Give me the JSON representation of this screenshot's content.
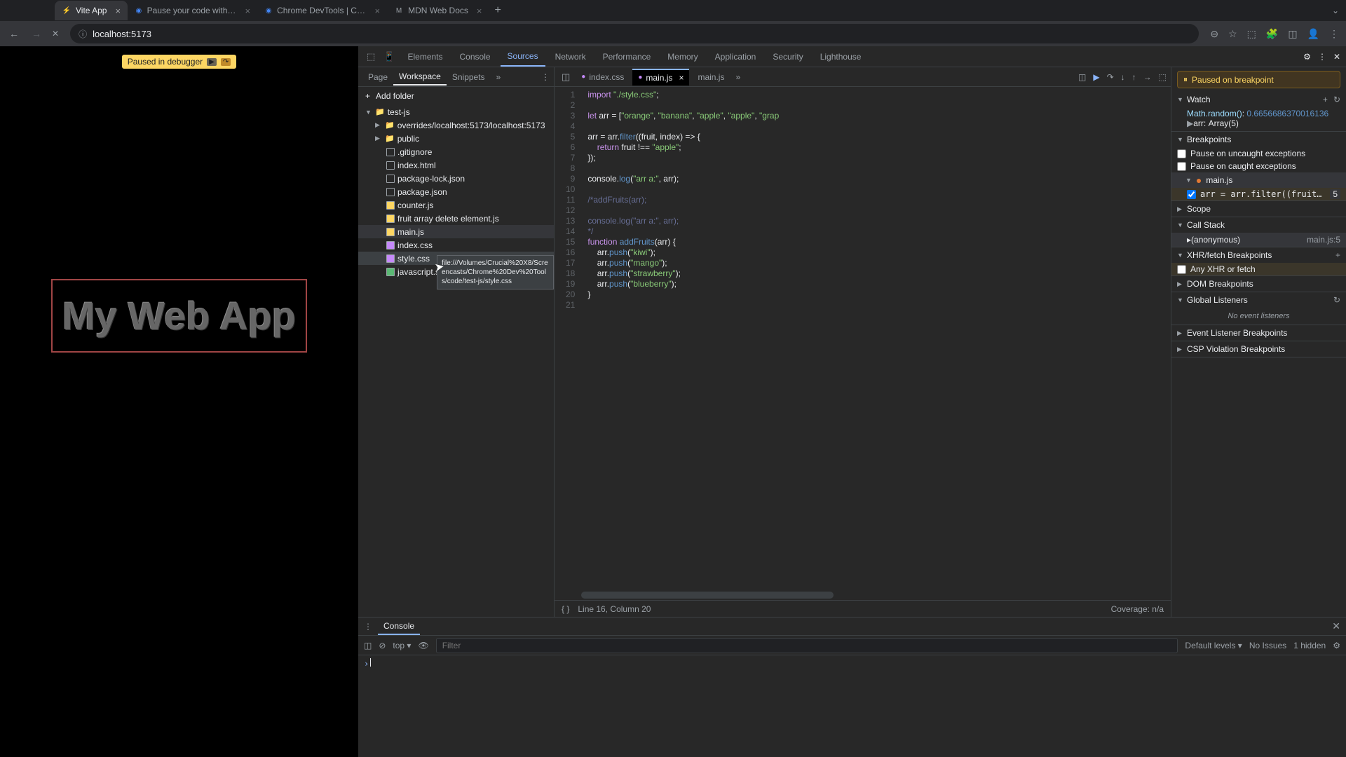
{
  "browser": {
    "tabs": [
      {
        "title": "Vite App",
        "favicon": "⚡"
      },
      {
        "title": "Pause your code with breakp",
        "favicon": "◉"
      },
      {
        "title": "Chrome DevTools | Chrome",
        "favicon": "◉"
      },
      {
        "title": "MDN Web Docs",
        "favicon": "M"
      }
    ],
    "url": "localhost:5173"
  },
  "page": {
    "pause_badge": "Paused in debugger",
    "app_title": "My Web App"
  },
  "devtools": {
    "tabs": [
      "Elements",
      "Console",
      "Sources",
      "Network",
      "Performance",
      "Memory",
      "Application",
      "Security",
      "Lighthouse"
    ],
    "active_tab": "Sources"
  },
  "sources_nav": {
    "tabs": [
      "Page",
      "Workspace",
      "Snippets"
    ],
    "active": "Workspace",
    "add_folder": "Add folder",
    "tree": {
      "root": "test-js",
      "overrides": "overrides/localhost:5173/localhost:5173",
      "public": "public",
      "files": [
        ".gitignore",
        "index.html",
        "package-lock.json",
        "package.json",
        "counter.js",
        "fruit array delete element.js",
        "main.js",
        "index.css",
        "style.css",
        "javascript.svg"
      ]
    },
    "tooltip": "file:///Volumes/Crucial%20X8/Screencasts/Chrome%20Dev%20Tools/code/test-js/style.css"
  },
  "editor": {
    "tabs": [
      {
        "name": "index.css"
      },
      {
        "name": "main.js",
        "active": true
      },
      {
        "name": "main.js"
      }
    ],
    "lines_count": 21,
    "code": {
      "l1": "import \"./style.css\";",
      "l3a": "let",
      "l3b": " arr = [",
      "l3c": "\"orange\"",
      "l3d": ", ",
      "l3e": "\"banana\"",
      "l3f": ", ",
      "l3g": "\"apple\"",
      "l3h": ", ",
      "l3i": "\"apple\"",
      "l3j": ", ",
      "l3k": "\"grap",
      "l5a": "arr = arr.",
      "l5b": "filter",
      "l5c": "((fruit, index) => {",
      "l6a": "    return",
      "l6b": " fruit !== ",
      "l6c": "\"apple\"",
      "l6d": ";",
      "l7": "});",
      "l9a": "console.",
      "l9b": "log",
      "l9c": "(",
      "l9d": "\"arr a:\"",
      "l9e": ", arr);",
      "l11": "/*addFruits(arr);",
      "l13": "console.log(\"arr a:\", arr);",
      "l14": "*/",
      "l15a": "function ",
      "l15b": "addFruits",
      "l15c": "(arr) {",
      "l16a": "    arr.",
      "l16b": "push",
      "l16c": "(",
      "l16d": "\"kiwi\"",
      "l16e": ");",
      "l17a": "    arr.",
      "l17b": "push",
      "l17c": "(",
      "l17d": "\"mango\"",
      "l17e": ");",
      "l18a": "    arr.",
      "l18b": "push",
      "l18c": "(",
      "l18d": "\"strawberry\"",
      "l18e": ");",
      "l19a": "    arr.",
      "l19b": "push",
      "l19c": "(",
      "l19d": "\"blueberry\"",
      "l19e": ");",
      "l20": "}"
    },
    "status_pos": "Line 16, Column 20",
    "coverage": "Coverage: n/a"
  },
  "debug": {
    "paused_msg": "Paused on breakpoint",
    "sections": {
      "watch": "Watch",
      "breakpoints": "Breakpoints",
      "scope": "Scope",
      "callstack": "Call Stack",
      "xhr": "XHR/fetch Breakpoints",
      "dom": "DOM Breakpoints",
      "global": "Global Listeners",
      "event": "Event Listener Breakpoints",
      "csp": "CSP Violation Breakpoints"
    },
    "watch_items": [
      {
        "expr": "Math.random()",
        "val": "0.6656686370016136"
      },
      {
        "expr": "arr",
        "val": "Array(5)"
      }
    ],
    "bp_options": {
      "uncaught": "Pause on uncaught exceptions",
      "caught": "Pause on caught exceptions"
    },
    "bp_file": "main.js",
    "bp_line": {
      "code": "arr = arr.filter((fruit, ind…",
      "num": "5"
    },
    "stack_frame": {
      "name": "(anonymous)",
      "loc": "main.js:5"
    },
    "xhr_any": "Any XHR or fetch",
    "no_listeners": "No event listeners"
  },
  "console": {
    "tab": "Console",
    "context": "top",
    "filter_placeholder": "Filter",
    "levels": "Default levels",
    "issues": "No Issues",
    "hidden": "1 hidden"
  }
}
